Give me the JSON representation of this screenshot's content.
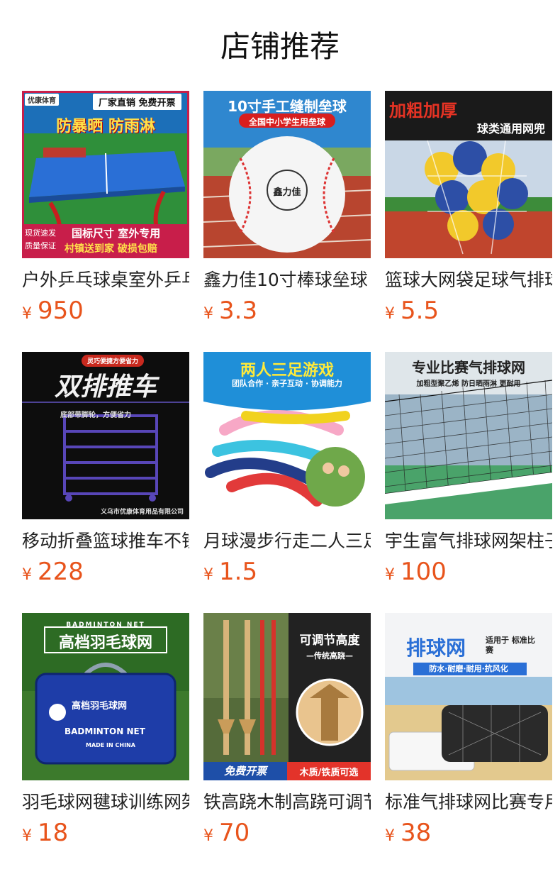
{
  "header": {
    "title": "店铺推荐"
  },
  "currency": "¥",
  "products": [
    {
      "name": "户外乒乓球桌室外乒乓球台",
      "price": "950",
      "image": {
        "icon": "ping-pong-table",
        "badge": "优康体育",
        "top_banner": "厂家直销 免费开票",
        "headline": "防暴晒 防雨淋",
        "bottom_banner": "国标尺寸 室外专用",
        "bottom_banner2": "村镇送到家 破损包赔",
        "side_note": "现货速发 质量保证"
      }
    },
    {
      "name": "鑫力佳10寸棒球垒球",
      "price": "3.3",
      "image": {
        "icon": "baseball",
        "headline": "10寸手工缝制垒球",
        "sub_banner": "全国中小学生用垒球",
        "ball_logo": "鑫力佳"
      }
    },
    {
      "name": "篮球大网袋足球气排球网兜",
      "price": "5.5",
      "image": {
        "icon": "ball-net-bag",
        "headline": "加粗加厚",
        "sub_headline": "球类通用网兜"
      }
    },
    {
      "name": "移动折叠篮球推车不锈钢",
      "price": "228",
      "image": {
        "icon": "ball-cart",
        "tag": "灵巧便捷方便省力",
        "headline": "双排推车",
        "caption": "底部带脚轮，方便省力",
        "footer": "义乌市优康体育用品有限公司"
      }
    },
    {
      "name": "月球漫步行走二人三足绑腿带",
      "price": "1.5",
      "image": {
        "icon": "leg-bands",
        "headline": "两人三足游戏",
        "sub_headline": "团队合作 · 亲子互动 · 协调能力"
      }
    },
    {
      "name": "宇生富气排球网架柱子",
      "price": "100",
      "image": {
        "icon": "volleyball-net",
        "headline": "专业比赛气排球网",
        "sub_headline": "加粗型聚乙烯 防日晒雨淋 更耐用"
      }
    },
    {
      "name": "羽毛球网毽球训练网架",
      "price": "18",
      "image": {
        "icon": "badminton-bag",
        "top_small": "BADMINTON NET",
        "headline": "高档羽毛球网",
        "bag_title": "高档羽毛球网",
        "bag_label": "BADMINTON NET",
        "bag_footer": "MADE IN CHINA"
      }
    },
    {
      "name": "铁高跷木制高跷可调节",
      "price": "70",
      "image": {
        "icon": "stilts",
        "headline": "可调节高度",
        "sub_headline": "—传统高跷—",
        "bottom_left": "免费开票",
        "bottom_right": "木质/铁质可选"
      }
    },
    {
      "name": "标准气排球网比赛专用网",
      "price": "38",
      "image": {
        "icon": "net-bag-beach",
        "headline": "排球网",
        "side_text": "适用于 标准比赛",
        "sub_banner": "防水·耐磨·耐用·抗风化"
      }
    }
  ]
}
